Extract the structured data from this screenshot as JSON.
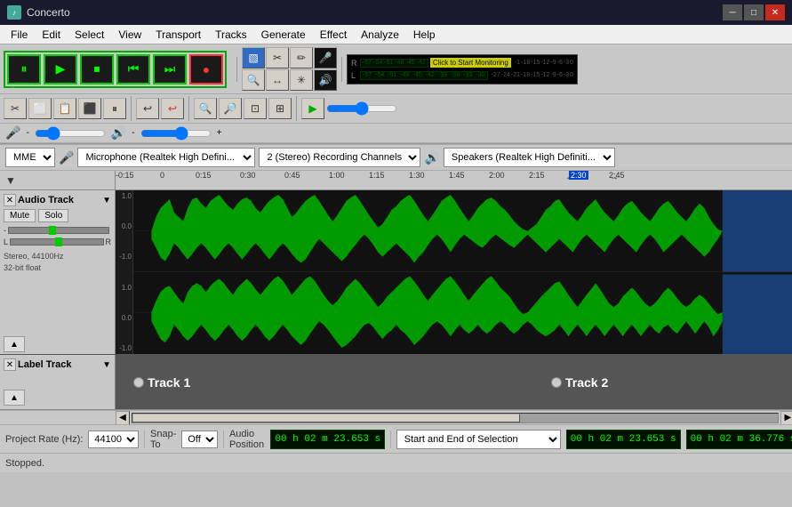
{
  "titleBar": {
    "icon": "♪",
    "title": "Concerto",
    "minimize": "─",
    "maximize": "□",
    "close": "✕"
  },
  "menu": {
    "items": [
      "File",
      "Edit",
      "Select",
      "View",
      "Transport",
      "Tracks",
      "Generate",
      "Effect",
      "Analyze",
      "Help"
    ]
  },
  "transport": {
    "pause": "⏸",
    "play": "▶",
    "stop": "⏹",
    "skipBack": "⏮",
    "skipForward": "⏭",
    "record": "●"
  },
  "deviceBar": {
    "driver": "MME",
    "microphone": "Microphone (Realtek High Defini...",
    "channels": "2 (Stereo) Recording Channels",
    "speakers": "Speakers (Realtek High Definiti..."
  },
  "ruler": {
    "marks": [
      "-0:15",
      "0",
      "0:15",
      "0:30",
      "0:45",
      "1:00",
      "1:15",
      "1:30",
      "1:45",
      "2:00",
      "2:15",
      "2:30",
      "2:45"
    ]
  },
  "audioTrack": {
    "name": "Audio Track",
    "close": "✕",
    "mute": "Mute",
    "solo": "Solo",
    "gainLabel": "-",
    "panLabel": "L",
    "panLabelR": "R",
    "info": "Stereo, 44100Hz\n32-bit float"
  },
  "labelTrack": {
    "name": "Label Track",
    "label1": "Track 1",
    "label2": "Track 2"
  },
  "projectBar": {
    "rateLabel": "Project Rate (Hz):",
    "rateValue": "44100",
    "snapLabel": "Snap-To",
    "snapValue": "Off",
    "audioPosLabel": "Audio Position",
    "selectionType": "Start and End of Selection",
    "time1": "00 h 02 m 23.653 s",
    "time2": "00 h 02 m 23.653 s",
    "time3": "00 h 02 m 36.776 s"
  },
  "statusBar": {
    "text": "Stopped."
  },
  "monitoring": {
    "label": "Click to Start Monitoring"
  }
}
